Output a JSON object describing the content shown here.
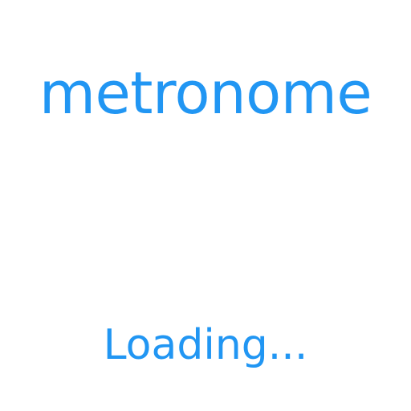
{
  "app": {
    "title": "metronome",
    "status": "Loading..."
  },
  "colors": {
    "accent": "#2196F3",
    "background": "#ffffff"
  }
}
